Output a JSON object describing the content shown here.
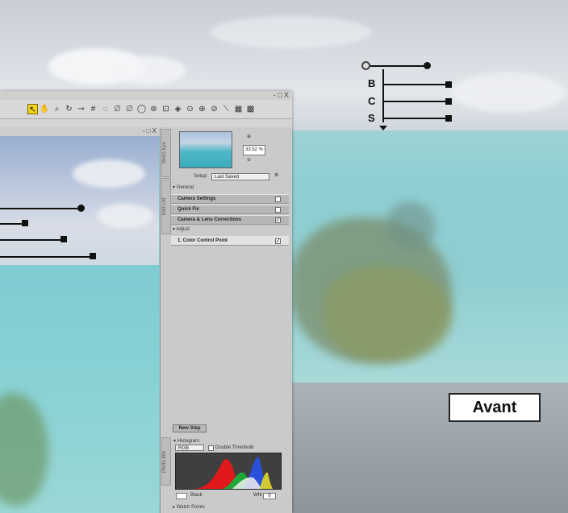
{
  "label": "Avant",
  "control_point": {
    "slider_labels": [
      "B",
      "C",
      "S"
    ]
  },
  "app": {
    "window_buttons": "- □ X",
    "image_window_buttons": "- □ X",
    "zoom_level": "33.52 %",
    "setup_label": "Setup:",
    "setup_value": "Last Saved",
    "sections": {
      "general": "General",
      "adjust": "Adjust"
    },
    "rows": [
      "Camera Settings",
      "Quick Fix",
      "Camera & Lens Corrections",
      "1. Color Control Point"
    ],
    "new_step_button": "New Step",
    "histogram": {
      "title": "Histogram",
      "channel": "RGB",
      "double_threshold": "Double Threshold",
      "black_label": "Black",
      "white_label": "Wht",
      "white_value": "0"
    },
    "watch_points": "Watch Points",
    "side_tabs": [
      "Bird's Eye",
      "Edit List",
      "Photo Info"
    ]
  },
  "colors": {
    "highlight": "#f1d21a",
    "sea": "#8ecdd0"
  },
  "icons": [
    "direct-select-icon",
    "hand-icon",
    "zoom-icon",
    "rotate-icon",
    "straighten-icon",
    "crop-icon",
    "red-eye-icon",
    "black-point-icon",
    "neutral-point-icon",
    "white-point-icon",
    "brush-icon",
    "selection-icon",
    "eraser-icon",
    "control-point-icon",
    "add-point-icon",
    "line-icon",
    "heal-icon",
    "grid-icon"
  ]
}
